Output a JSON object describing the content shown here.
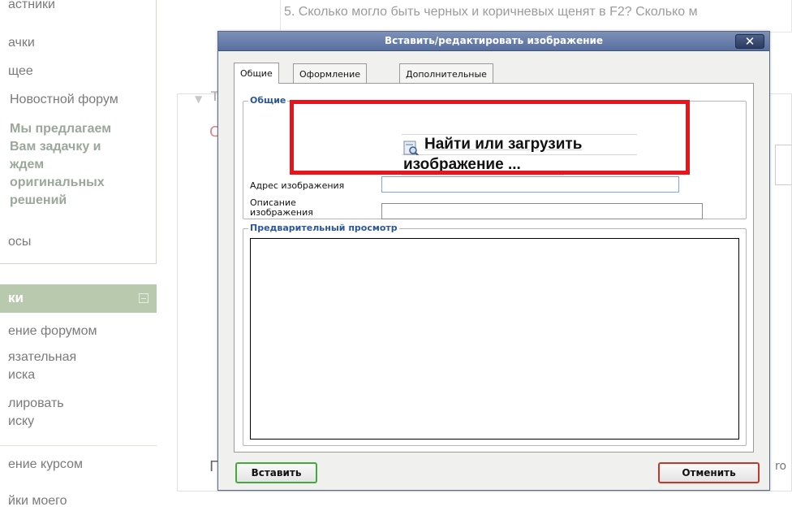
{
  "background": {
    "question_text": "5. Сколько могло быть черных и коричневых щенят в F2? Сколько м",
    "sidebar_top_items": [
      "астники",
      "ачки",
      "щее",
      "Новостной форум"
    ],
    "sidebar_bold_item": [
      "Мы предлагаем",
      "Вам задачку и",
      "ждем",
      "оригинальных",
      "решений"
    ],
    "sidebar_after_bold": "осы",
    "sidebar_block2_title": "ки",
    "sidebar_block2_items": [
      "ение форумом",
      "язательная",
      "иска",
      "лировать",
      "иску",
      "ение курсом",
      "йки моего"
    ],
    "bg_t": "Т",
    "bg_c": "С",
    "bg_p": "П",
    "bg_rg": "ro"
  },
  "dialog": {
    "title": "Вставить/редактировать изображение",
    "close_label": "✕",
    "tabs": [
      {
        "label": "Общие",
        "active": true
      },
      {
        "label": "Оформление",
        "active": false
      },
      {
        "label": "Дополнительные",
        "active": false
      }
    ],
    "general": {
      "legend": "Общие",
      "browse_line1": "Найти или загрузить",
      "browse_line2": "изображение ...",
      "url_label": "Адрес изображения",
      "url_value": "",
      "desc_label_1": "Описание",
      "desc_label_2": "изображения",
      "desc_value": ""
    },
    "preview": {
      "legend": "Предварительный просмотр"
    },
    "insert_label": "Вставить",
    "cancel_label": "Отменить"
  },
  "colors": {
    "highlight": "#e8141b",
    "legend_blue": "#2b5797",
    "sidebar_header": "#b8c9ad"
  }
}
